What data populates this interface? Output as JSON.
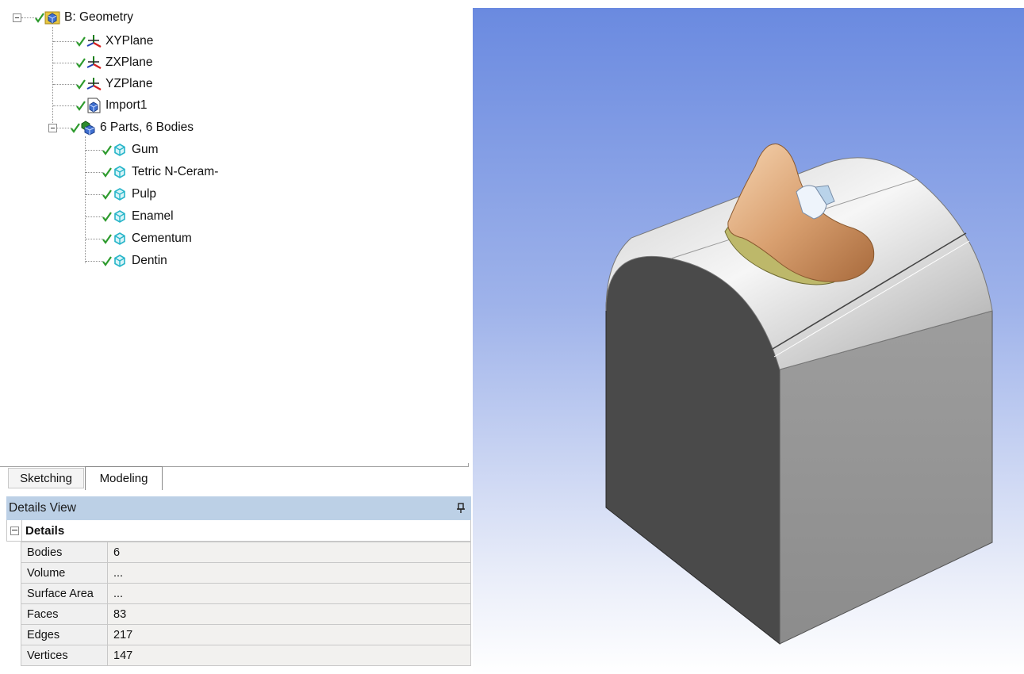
{
  "tree": {
    "root": {
      "label": "B: Geometry",
      "icon": "geometry-icon"
    },
    "planes": [
      {
        "label": "XYPlane",
        "icon": "plane-axes-icon"
      },
      {
        "label": "ZXPlane",
        "icon": "plane-axes-icon"
      },
      {
        "label": "YZPlane",
        "icon": "plane-axes-icon"
      }
    ],
    "import": {
      "label": "Import1",
      "icon": "import-icon"
    },
    "parts_group": {
      "label": "6 Parts, 6 Bodies",
      "icon": "parts-icon"
    },
    "bodies": [
      {
        "label": "Gum",
        "icon": "body-icon"
      },
      {
        "label": "Tetric N-Ceram-",
        "icon": "body-icon"
      },
      {
        "label": "Pulp",
        "icon": "body-icon"
      },
      {
        "label": "Enamel",
        "icon": "body-icon"
      },
      {
        "label": "Cementum",
        "icon": "body-icon"
      },
      {
        "label": "Dentin",
        "icon": "body-icon"
      }
    ]
  },
  "tabs": [
    {
      "label": "Sketching",
      "active": false
    },
    {
      "label": "Modeling",
      "active": true
    }
  ],
  "details_view": {
    "title": "Details View",
    "pin_icon": "pin-icon",
    "section_title": "Details",
    "rows": [
      {
        "key": "Bodies",
        "value": "6"
      },
      {
        "key": "Volume",
        "value": "..."
      },
      {
        "key": "Surface Area",
        "value": "..."
      },
      {
        "key": "Faces",
        "value": "83"
      },
      {
        "key": "Edges",
        "value": "217"
      },
      {
        "key": "Vertices",
        "value": "147"
      }
    ]
  },
  "colors": {
    "header_blue": "#bcd0e6",
    "viewport_top": "#6a8ae0",
    "check_green": "#2e9b2e",
    "body_icon_cyan": "#27b5c9"
  }
}
